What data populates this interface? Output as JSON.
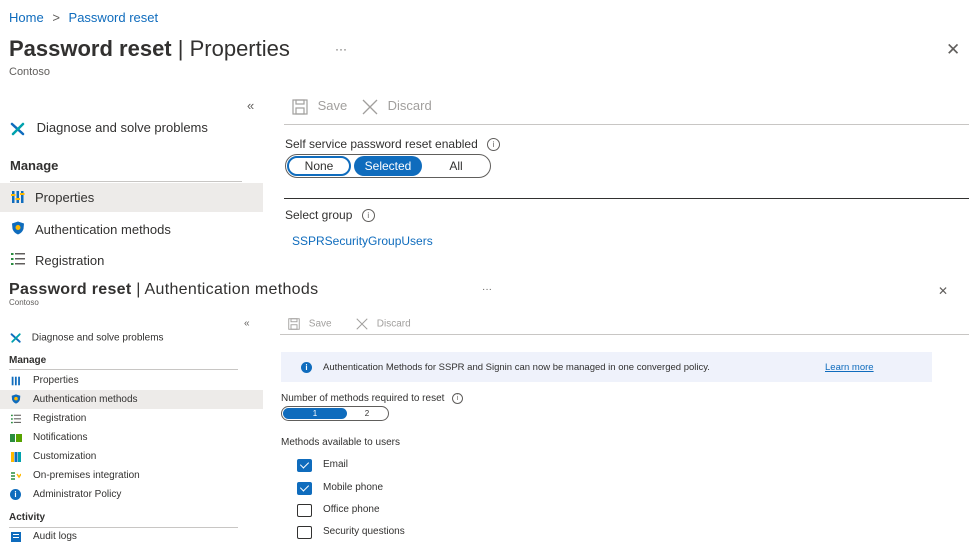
{
  "top": {
    "breadcrumb": [
      "Home",
      "Password reset"
    ],
    "title_bold": "Password reset",
    "title_rest": "| Properties",
    "subtitle": "Contoso",
    "more": "···",
    "close": "✕",
    "collapse": "«",
    "sidebar": {
      "diagnose": "Diagnose and solve problems",
      "manage": "Manage",
      "items": [
        "Properties",
        "Authentication methods",
        "Registration"
      ]
    },
    "toolbar": {
      "save": "Save",
      "discard": "Discard"
    },
    "sspr_label": "Self service password reset enabled",
    "sspr_options": [
      "None",
      "Selected",
      "All"
    ],
    "select_group_label": "Select group",
    "group_value": "SSPRSecurityGroupUsers"
  },
  "bottom": {
    "title_bold": "Password reset",
    "title_rest": "| Authentication methods",
    "subtitle": "Contoso",
    "more": "···",
    "close": "✕",
    "collapse": "«",
    "sidebar": {
      "diagnose": "Diagnose and solve problems",
      "manage": "Manage",
      "items": [
        "Properties",
        "Authentication methods",
        "Registration",
        "Notifications",
        "Customization",
        "On-premises integration",
        "Administrator Policy"
      ],
      "activity": "Activity",
      "activity_items": [
        "Audit logs"
      ]
    },
    "toolbar": {
      "save": "Save",
      "discard": "Discard"
    },
    "banner_text": "Authentication Methods for SSPR and Signin can now be managed in one converged policy.",
    "banner_link": "Learn more",
    "methods_required_label": "Number of methods required to reset",
    "methods_required_options": [
      "1",
      "2"
    ],
    "methods_available_label": "Methods available to users",
    "methods": [
      "Email",
      "Mobile phone",
      "Office phone",
      "Security questions"
    ],
    "methods_checked": [
      true,
      true,
      false,
      false
    ]
  }
}
